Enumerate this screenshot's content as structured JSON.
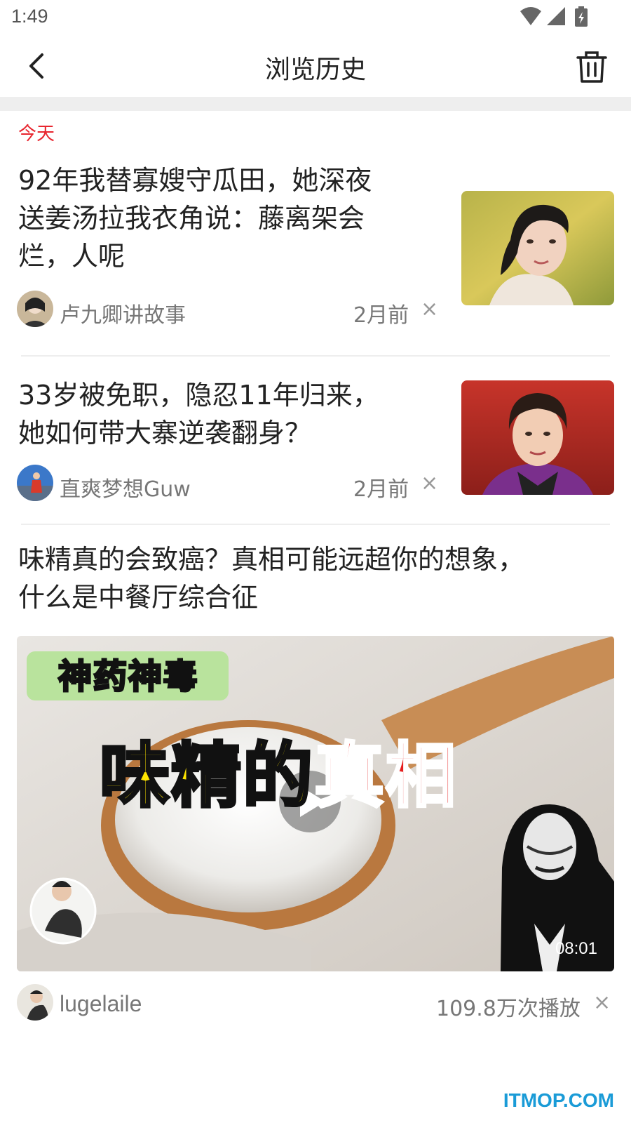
{
  "status_bar": {
    "time": "1:49",
    "icons": [
      "wifi-icon",
      "signal-icon",
      "battery-icon"
    ]
  },
  "header": {
    "title": "浏览历史",
    "back_icon": "chevron-left-icon",
    "delete_icon": "trash-icon"
  },
  "section": {
    "label": "今天",
    "color": "#e8262f"
  },
  "items": [
    {
      "title_lines": [
        "92年我替寡嫂守瓜田，她深夜",
        "送姜汤拉我衣角说：藤离架会",
        "烂，人呢"
      ],
      "author": "卢九卿讲故事",
      "time": "2月前",
      "close": "×"
    },
    {
      "title_lines": [
        "33岁被免职，隐忍11年归来，",
        "她如何带大寨逆袭翻身？"
      ],
      "author": "直爽梦想Guw",
      "time": "2月前",
      "close": "×"
    },
    {
      "title_lines": [
        "味精真的会致癌？真相可能远超你的想象，",
        "什么是中餐厅综合征"
      ],
      "video": {
        "tag_text": "神药神毒",
        "headline_yellow": "味精的",
        "headline_red": "真相",
        "duration": "08:01"
      },
      "author": "lugelaile",
      "plays": "109.8万次播放",
      "close": "×"
    }
  ],
  "watermark": "ITMOP.COM"
}
